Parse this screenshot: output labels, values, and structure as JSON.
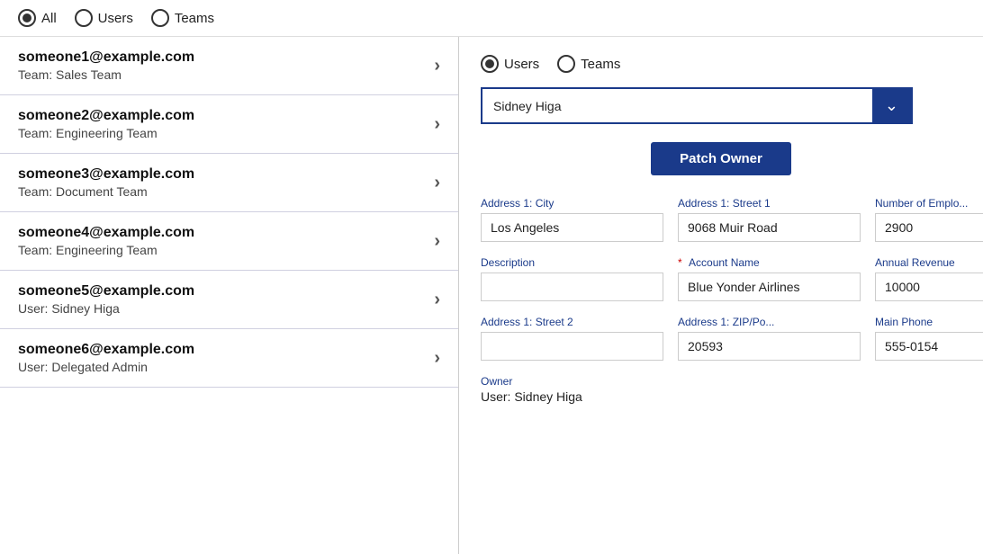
{
  "top_radio": {
    "options": [
      {
        "id": "all",
        "label": "All",
        "selected": true
      },
      {
        "id": "users",
        "label": "Users",
        "selected": false
      },
      {
        "id": "teams",
        "label": "Teams",
        "selected": false
      }
    ]
  },
  "list": {
    "items": [
      {
        "email": "someone1@example.com",
        "subtitle": "Team: Sales Team"
      },
      {
        "email": "someone2@example.com",
        "subtitle": "Team: Engineering Team"
      },
      {
        "email": "someone3@example.com",
        "subtitle": "Team: Document Team"
      },
      {
        "email": "someone4@example.com",
        "subtitle": "Team: Engineering Team"
      },
      {
        "email": "someone5@example.com",
        "subtitle": "User: Sidney Higa"
      },
      {
        "email": "someone6@example.com",
        "subtitle": "User: Delegated Admin"
      }
    ],
    "chevron": "›"
  },
  "right": {
    "radio_options": [
      {
        "id": "users",
        "label": "Users",
        "selected": true
      },
      {
        "id": "teams",
        "label": "Teams",
        "selected": false
      }
    ],
    "dropdown": {
      "value": "Sidney Higa",
      "chevron": "∨"
    },
    "patch_owner_btn": "Patch Owner",
    "form": {
      "fields": [
        {
          "label": "Address 1: City",
          "value": "Los Angeles",
          "required": false,
          "row": 1,
          "col": 1
        },
        {
          "label": "Address 1: Street 1",
          "value": "9068 Muir Road",
          "required": false,
          "row": 1,
          "col": 2
        },
        {
          "label": "Number of Emplo...",
          "value": "2900",
          "required": false,
          "row": 1,
          "col": 3
        },
        {
          "label": "Description",
          "value": "",
          "required": false,
          "row": 2,
          "col": 1
        },
        {
          "label": "Account Name",
          "value": "Blue Yonder Airlines",
          "required": true,
          "row": 2,
          "col": 2
        },
        {
          "label": "Annual Revenue",
          "value": "10000",
          "required": false,
          "row": 2,
          "col": 3
        },
        {
          "label": "Address 1: Street 2",
          "value": "",
          "required": false,
          "row": 3,
          "col": 1
        },
        {
          "label": "Address 1: ZIP/Po...",
          "value": "20593",
          "required": false,
          "row": 3,
          "col": 2
        },
        {
          "label": "Main Phone",
          "value": "555-0154",
          "required": false,
          "row": 3,
          "col": 3
        }
      ]
    },
    "owner": {
      "label": "Owner",
      "value": "User: Sidney Higa"
    }
  }
}
